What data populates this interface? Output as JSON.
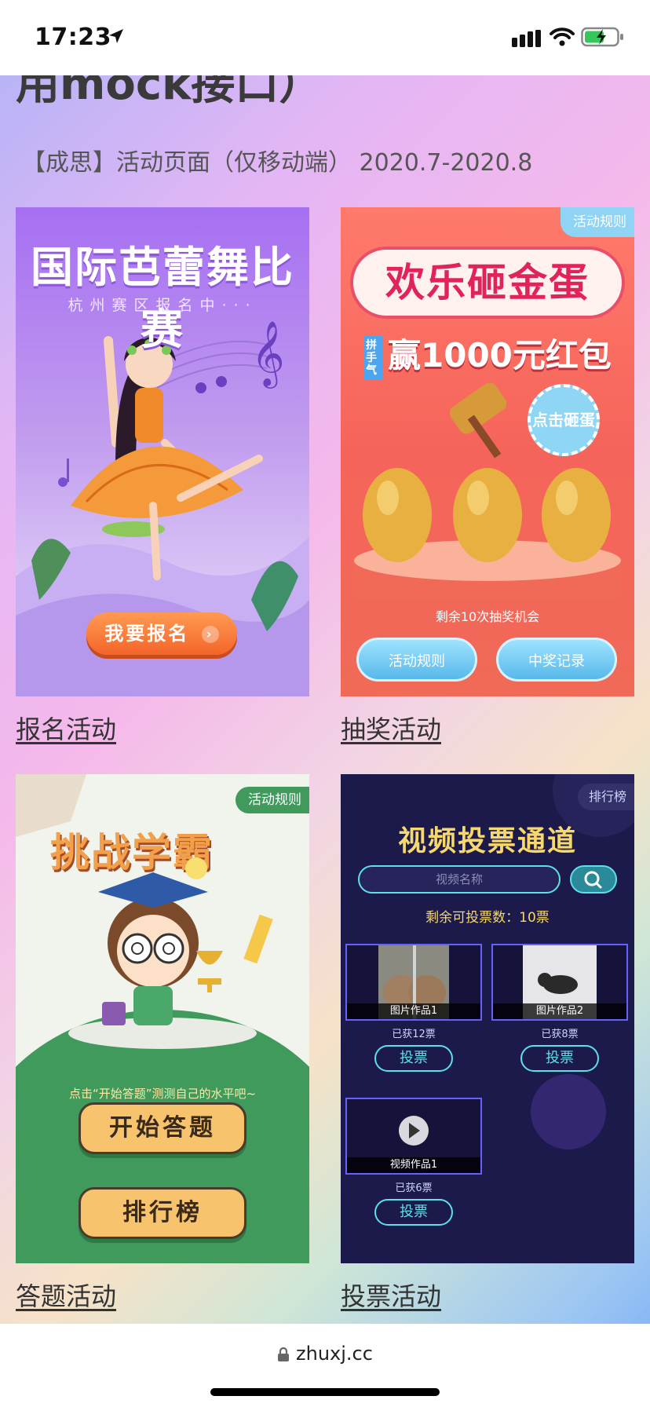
{
  "status_bar": {
    "time": "17:23"
  },
  "page": {
    "cut_title": "用mock接口）",
    "subtitle": "【成思】活动页面（仅移动端） 2020.7-2020.8"
  },
  "cards": [
    {
      "caption": "报名活动",
      "screenshot": {
        "title": "国际芭蕾舞比赛",
        "subtitle": "杭州赛区报名中···",
        "button": "我要报名"
      }
    },
    {
      "caption": "抽奖活动",
      "screenshot": {
        "rule_tag": "活动规则",
        "title": "欢乐砸金蛋",
        "prize_tag": "拼手气",
        "prize": "赢1000元红包",
        "hit_button": "点击砸蛋",
        "remaining": "剩余10次抽奖机会",
        "left_button": "活动规则",
        "right_button": "中奖记录"
      }
    },
    {
      "caption": "答题活动",
      "screenshot": {
        "rule_tag": "活动规则",
        "title": "挑战学霸",
        "hint": "点击“开始答题”测测自己的水平吧~",
        "start_button": "开始答题",
        "rank_button": "排行榜"
      }
    },
    {
      "caption": "投票活动",
      "screenshot": {
        "rank_tag": "排行榜",
        "title": "视频投票通道",
        "search_placeholder": "视频名称",
        "remaining": "剩余可投票数：10票",
        "vote_button": "投票",
        "items": [
          {
            "label": "图片作品1",
            "count": "已获12票"
          },
          {
            "label": "图片作品2",
            "count": "已获8票"
          },
          {
            "label": "视频作品1",
            "count": "已获6票"
          }
        ]
      }
    }
  ],
  "browser": {
    "url": "zhuxj.cc"
  },
  "colors": {
    "ballet_purple": "#a66ff2",
    "eggs_red": "#f5645a",
    "quiz_green": "#3f9a5c",
    "vote_navy": "#1c1a4a"
  }
}
